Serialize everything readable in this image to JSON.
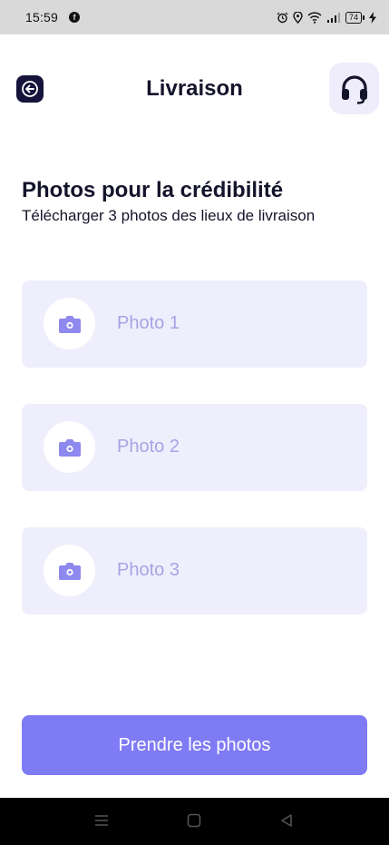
{
  "status_bar": {
    "time": "15:59",
    "battery": "74",
    "icons": [
      "facebook-icon",
      "alarm-icon",
      "location-icon",
      "wifi-icon",
      "signal-icon",
      "battery-icon",
      "charging-icon"
    ]
  },
  "header": {
    "title": "Livraison",
    "back_icon": "arrow-left-icon",
    "support_icon": "headset-icon"
  },
  "section": {
    "title": "Photos pour la crédibilité",
    "subtitle": "Télécharger 3 photos des lieux de livraison"
  },
  "photos": [
    {
      "label": "Photo 1",
      "icon": "camera-icon"
    },
    {
      "label": "Photo 2",
      "icon": "camera-icon"
    },
    {
      "label": "Photo 3",
      "icon": "camera-icon"
    }
  ],
  "cta": {
    "label": "Prendre les photos"
  },
  "colors": {
    "accent": "#7f7bf4",
    "card_bg": "#efeefc",
    "dark": "#16143a",
    "placeholder_text": "#a7a4e6"
  },
  "nav_bar": {
    "icons": [
      "menu-icon",
      "home-icon",
      "back-icon"
    ]
  }
}
